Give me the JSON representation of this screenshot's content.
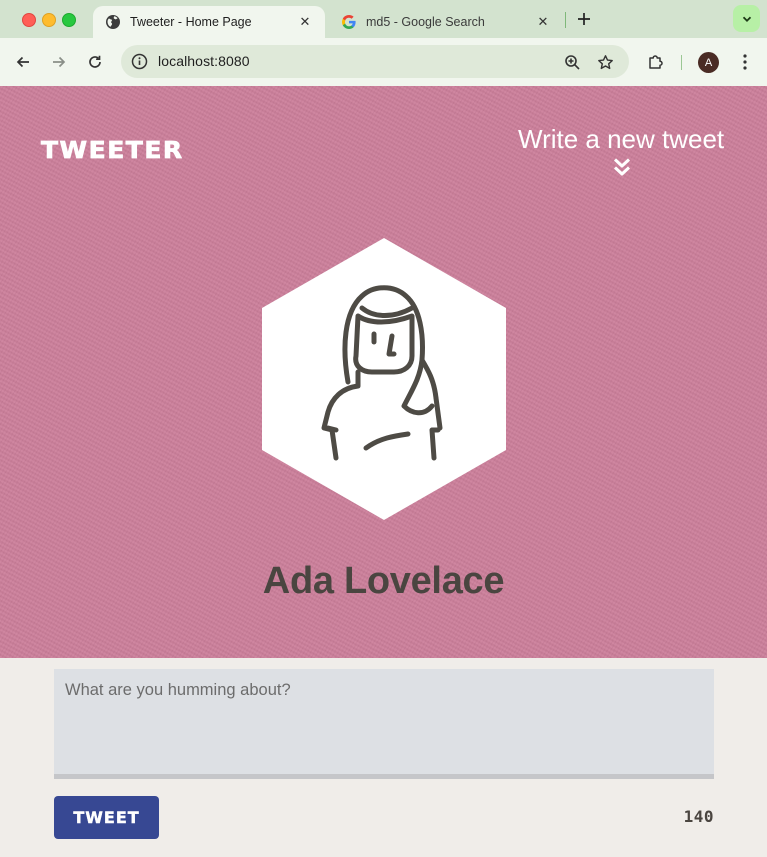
{
  "browser": {
    "tabs": [
      {
        "title": "Tweeter - Home Page",
        "favicon": "globe-icon",
        "active": true
      },
      {
        "title": "md5 - Google Search",
        "favicon": "google-icon",
        "active": false
      }
    ],
    "address": "localhost:8080",
    "profile_initial": "A"
  },
  "nav": {
    "brand": "TWEETER",
    "compose_label": "Write a new tweet",
    "compose_icon": "double-chevron-down-icon"
  },
  "profile": {
    "name": "Ada Lovelace",
    "avatar_icon": "user-avatar-icon"
  },
  "composer": {
    "placeholder": "What are you humming about?",
    "submit_label": "TWEET",
    "counter": "140"
  },
  "colors": {
    "hero_bg": "#cc7f9b",
    "page_bg": "#f0ede9",
    "button_bg": "#374893",
    "text_dark": "#4a4540"
  }
}
